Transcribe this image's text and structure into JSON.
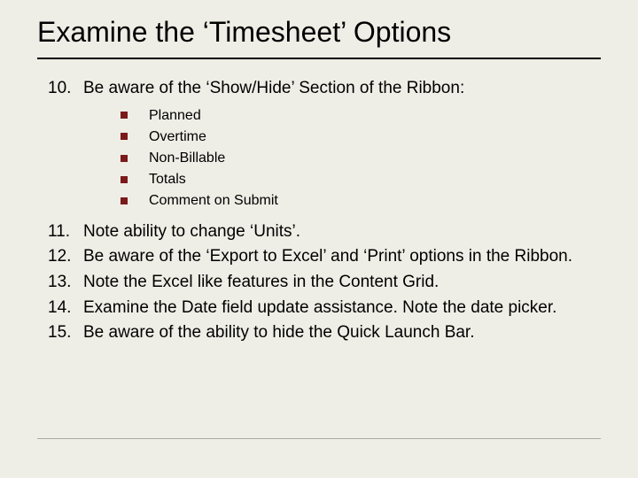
{
  "title": "Examine the ‘Timesheet’ Options",
  "items": [
    {
      "num": "10.",
      "text": "Be aware of the ‘Show/Hide’ Section of the Ribbon:"
    },
    {
      "num": "11.",
      "text": "Note ability to change ‘Units’."
    },
    {
      "num": "12.",
      "text": "Be aware of the ‘Export to Excel’ and ‘Print’ options in the Ribbon."
    },
    {
      "num": "13.",
      "text": "Note the Excel like features in the Content Grid."
    },
    {
      "num": "14.",
      "text": "Examine the Date field update assistance. Note the date picker."
    },
    {
      "num": "15.",
      "text": "Be aware of the ability to hide the Quick Launch Bar."
    }
  ],
  "sub_items": [
    "Planned",
    "Overtime",
    "Non-Billable",
    "Totals",
    "Comment on Submit"
  ]
}
